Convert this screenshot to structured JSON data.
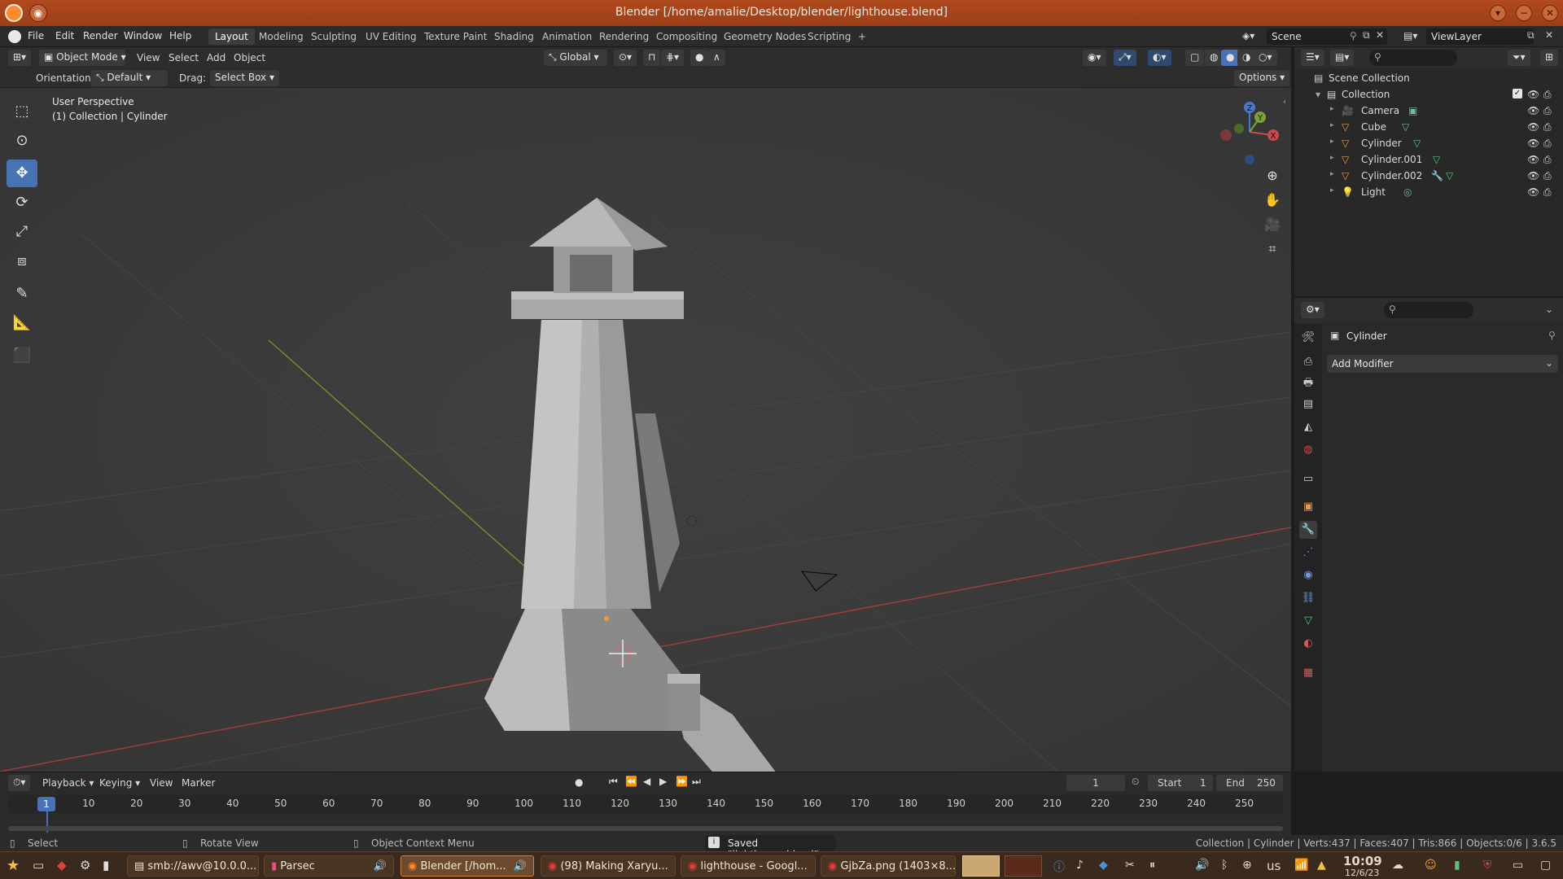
{
  "window": {
    "title": "Blender [/home/amalie/Desktop/blender/lighthouse.blend]"
  },
  "menu": {
    "items": [
      "File",
      "Edit",
      "Render",
      "Window",
      "Help"
    ],
    "workspaces": [
      "Layout",
      "Modeling",
      "Sculpting",
      "UV Editing",
      "Texture Paint",
      "Shading",
      "Animation",
      "Rendering",
      "Compositing",
      "Geometry Nodes",
      "Scripting"
    ],
    "active_workspace": "Layout",
    "add_tab": "+",
    "scene": "Scene",
    "view_layer": "ViewLayer"
  },
  "viewport_header": {
    "mode": "Object Mode",
    "menus": [
      "View",
      "Select",
      "Add",
      "Object"
    ],
    "transform": "Global",
    "orientation_label": "Orientation:",
    "orientation_value": "Default",
    "drag_label": "Drag:",
    "drag_value": "Select Box",
    "options": "Options"
  },
  "viewport": {
    "perspective": "User Perspective",
    "context": "(1) Collection | Cylinder"
  },
  "outliner": {
    "root": "Scene Collection",
    "collection": "Collection",
    "objects": [
      "Camera",
      "Cube",
      "Cylinder",
      "Cylinder.001",
      "Cylinder.002",
      "Light"
    ]
  },
  "properties": {
    "object_name": "Cylinder",
    "add_modifier": "Add Modifier"
  },
  "timeline": {
    "menus": [
      "Playback",
      "Keying",
      "View",
      "Marker"
    ],
    "current_frame": "1",
    "start_label": "Start",
    "start_value": "1",
    "end_label": "End",
    "end_value": "250",
    "ticks": [
      "1",
      "10",
      "20",
      "30",
      "40",
      "50",
      "60",
      "70",
      "80",
      "90",
      "100",
      "110",
      "120",
      "130",
      "140",
      "150",
      "160",
      "170",
      "180",
      "190",
      "200",
      "210",
      "220",
      "230",
      "240",
      "250"
    ]
  },
  "statusbar": {
    "select": "Select",
    "rotate": "Rotate View",
    "context_menu": "Object Context Menu",
    "message": "Saved \"lighthouse.blend\"",
    "stats": "Collection | Cylinder | Verts:437 | Faces:407 | Tris:866 | Objects:0/6 | 3.6.5"
  },
  "taskbar": {
    "tasks": [
      "smb://awv@10.0.0...",
      "Parsec",
      "Blender [/hom...",
      "(98) Making Xaryu...",
      "lighthouse - Googl...",
      "GjbZa.png (1403×8..."
    ],
    "active_task": "Blender [/hom...",
    "keyboard": "us",
    "time": "10:09",
    "date": "12/6/23"
  },
  "colors": {
    "titlebar": "#b04a1e",
    "accent": "#4772b3",
    "viewport_bg": "#3b3b3b",
    "x_axis": "#b03a3a",
    "y_axis": "#7aa23a",
    "z_axis": "#4a78c8"
  }
}
